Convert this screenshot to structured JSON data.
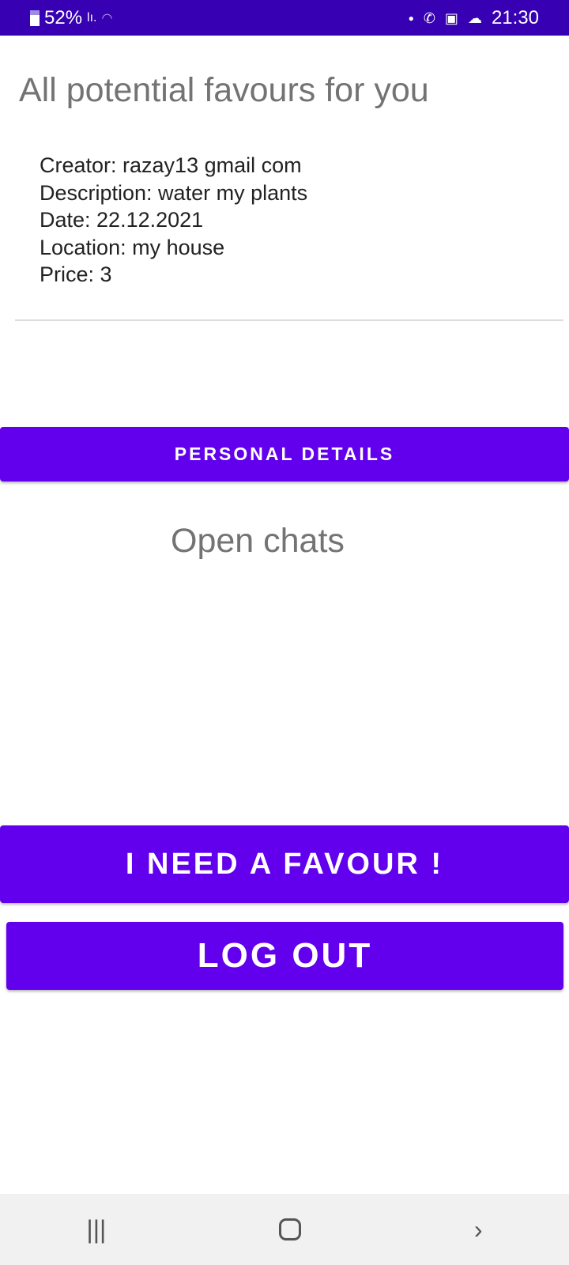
{
  "status_bar": {
    "battery": "52%",
    "time": "21:30"
  },
  "page": {
    "title": "All potential favours for you",
    "chats_title": "Open chats"
  },
  "favours": [
    {
      "creator": "Creator: razay13 gmail com",
      "description": "Description: water my plants",
      "date": "Date: 22.12.2021",
      "location": "Location: my house",
      "price": "Price: 3"
    }
  ],
  "buttons": {
    "personal_details": "PERSONAL DETAILS",
    "need_favour": "I NEED A FAVOUR !",
    "log_out": "LOG OUT"
  },
  "colors": {
    "status_bar": "#3700b3",
    "primary": "#6200ee"
  }
}
